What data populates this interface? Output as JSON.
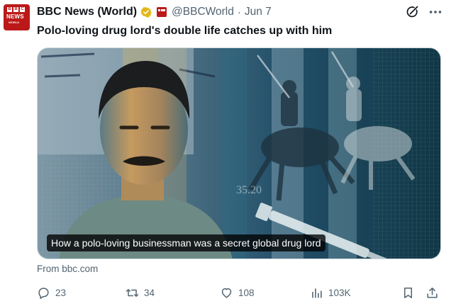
{
  "author": {
    "display_name": "BBC News (World)",
    "handle": "@BBCWorld",
    "separator": "·",
    "date": "Jun 7",
    "avatar": {
      "letters": [
        "B",
        "B",
        "C"
      ],
      "line1": "NEWS",
      "line2": "WORLD"
    },
    "verified_badge_color": "#e2b719",
    "affiliate_badge_color": "#bb1919"
  },
  "tweet": {
    "text": "Polo-loving drug lord's double life catches up with him"
  },
  "card": {
    "caption": "How a polo-loving businessman was a secret global drug lord",
    "source": "From bbc.com"
  },
  "actions": {
    "replies": "23",
    "reposts": "34",
    "likes": "108",
    "views": "103K"
  },
  "icons": [
    "grok-icon",
    "more-icon",
    "reply-icon",
    "repost-icon",
    "like-icon",
    "views-icon",
    "bookmark-icon",
    "share-icon"
  ]
}
